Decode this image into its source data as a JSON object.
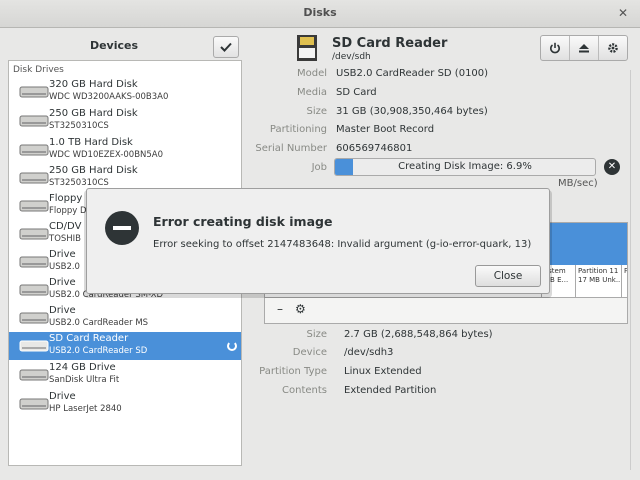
{
  "window": {
    "title": "Disks"
  },
  "sidebar": {
    "title": "Devices",
    "section": "Disk Drives",
    "drives": [
      {
        "name": "320 GB Hard Disk",
        "detail": "WDC WD3200AAKS-00B3A0"
      },
      {
        "name": "250 GB Hard Disk",
        "detail": "ST3250310CS"
      },
      {
        "name": "1.0 TB Hard Disk",
        "detail": "WDC WD10EZEX-00BN5A0"
      },
      {
        "name": "250 GB Hard Disk",
        "detail": "ST3250310CS"
      },
      {
        "name": "Floppy",
        "detail": "Floppy D"
      },
      {
        "name": "CD/DV",
        "detail": "TOSHIB"
      },
      {
        "name": "Drive",
        "detail": "USB2.0"
      },
      {
        "name": "Drive",
        "detail": "USB2.0 CardReader SM-XD"
      },
      {
        "name": "Drive",
        "detail": "USB2.0 CardReader MS"
      },
      {
        "name": "SD Card Reader",
        "detail": "USB2.0 CardReader SD"
      },
      {
        "name": "124 GB Drive",
        "detail": "SanDisk Ultra Fit"
      },
      {
        "name": "Drive",
        "detail": "HP LaserJet 2840"
      }
    ]
  },
  "device": {
    "title": "SD Card Reader",
    "path": "/dev/sdh",
    "fields": [
      {
        "label": "Model",
        "value": "USB2.0 CardReader SD (0100)"
      },
      {
        "label": "Media",
        "value": "SD Card"
      },
      {
        "label": "Size",
        "value": "31 GB (30,908,350,464 bytes)"
      },
      {
        "label": "Partitioning",
        "value": "Master Boot Record"
      },
      {
        "label": "Serial Number",
        "value": "606569746801"
      }
    ],
    "job_label": "Job",
    "job_text": "Creating Disk Image: 6.9%",
    "job_progress": 0.069,
    "job_speed_partial": "MB/sec)"
  },
  "volumes": {
    "segments": [
      {
        "text": "ystem\nMB E..."
      },
      {
        "text": "Partition 11\n17 MB Unk..."
      },
      {
        "text": "P"
      }
    ]
  },
  "partition": {
    "fields": [
      {
        "label": "Size",
        "value": "2.7 GB (2,688,548,864 bytes)"
      },
      {
        "label": "Device",
        "value": "/dev/sdh3"
      },
      {
        "label": "Partition Type",
        "value": "Linux Extended"
      },
      {
        "label": "Contents",
        "value": "Extended Partition"
      }
    ]
  },
  "dialog": {
    "title": "Error creating disk image",
    "message": "Error seeking to offset 2147483648: Invalid argument (g-io-error-quark, 13)",
    "close_label": "Close"
  },
  "colors": {
    "accent": "#4a90d9",
    "text": "#2e3436",
    "label": "#888a85"
  }
}
